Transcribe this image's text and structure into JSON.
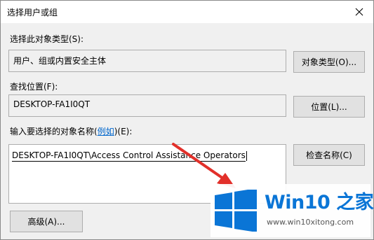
{
  "window": {
    "title": "选择用户或组"
  },
  "object_types": {
    "label": "选择此对象类型(S):",
    "value": "用户、组或内置安全主体",
    "button": "对象类型(O)..."
  },
  "location": {
    "label": "查找位置(F):",
    "value": "DESKTOP-FA1I0QT",
    "button": "位置(L)..."
  },
  "names": {
    "label_prefix": "输入要选择的对象名称(",
    "label_link": "例如",
    "label_suffix": ")(E):",
    "value": "DESKTOP-FA1I0QT\\Access Control Assistance Operators",
    "check_button": "检查名称(C)"
  },
  "advanced_button": "高级(A)...",
  "watermark": {
    "brand_name": "Win10 之家",
    "url": "www.win10xitong.com",
    "colors": {
      "brand": "#0a75d6",
      "arrow": "#e2302a"
    }
  }
}
